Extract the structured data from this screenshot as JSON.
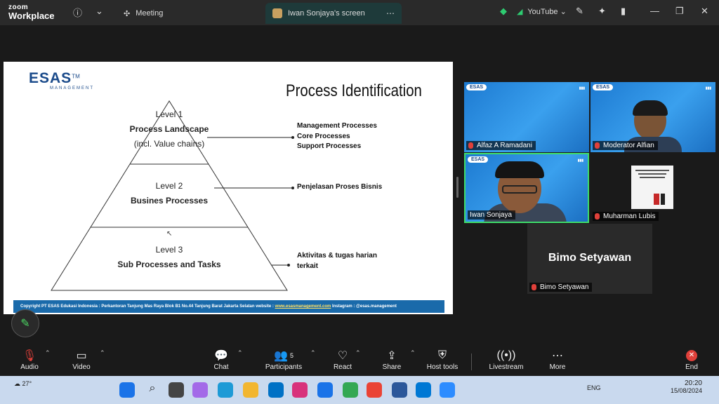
{
  "app": {
    "logo_top": "zoom",
    "logo_bottom": "Workplace"
  },
  "tabs": [
    {
      "label": "Meeting"
    },
    {
      "label": "Iwan Sonjaya's screen"
    }
  ],
  "topright": {
    "youtube_label": "YouTube"
  },
  "slide": {
    "brand": "ESAS",
    "brand_tm": "TM",
    "brand_sub": "MANAGEMENT",
    "title": "Process Identification",
    "level1": {
      "label": "Level 1",
      "bold": "Process Landscape",
      "note": "(incl. Value chains)"
    },
    "level2": {
      "label": "Level 2",
      "bold": "Busines Processes"
    },
    "level3": {
      "label": "Level 3",
      "bold": "Sub Processes and Tasks"
    },
    "right1": [
      "Management Processes",
      "Core Processes",
      "Support Processes"
    ],
    "right2": "Penjelasan Proses Bisnis",
    "right3a": "Aktivitas & tugas harian",
    "right3b": "terkait",
    "footer_pre": "Copyright PT ESAS Edukasi Indonesia : Perkantoran Tanjung Mas Raya Blok B1 No.44 Tanjung Barat Jakarta Selatan website : ",
    "footer_link": "www.esasmanagement.com",
    "footer_post": " Instagram : @esas.management"
  },
  "participants": [
    {
      "name": "Alfaz A Ramadani"
    },
    {
      "name": "Moderator Alfian"
    },
    {
      "name": "Iwan Sonjaya"
    },
    {
      "name": "Muharman Lubis"
    },
    {
      "name": "Bimo Setyawan",
      "display": "Bimo Setyawan"
    }
  ],
  "toolbar": {
    "audio": "Audio",
    "video": "Video",
    "chat": "Chat",
    "participants": "Participants",
    "participants_count": "5",
    "react": "React",
    "share": "Share",
    "host_tools": "Host tools",
    "livestream": "Livestream",
    "more": "More",
    "end": "End"
  },
  "taskbar": {
    "weather": "27°",
    "lang": "ENG",
    "time": "20:20",
    "date": "15/08/2024"
  }
}
